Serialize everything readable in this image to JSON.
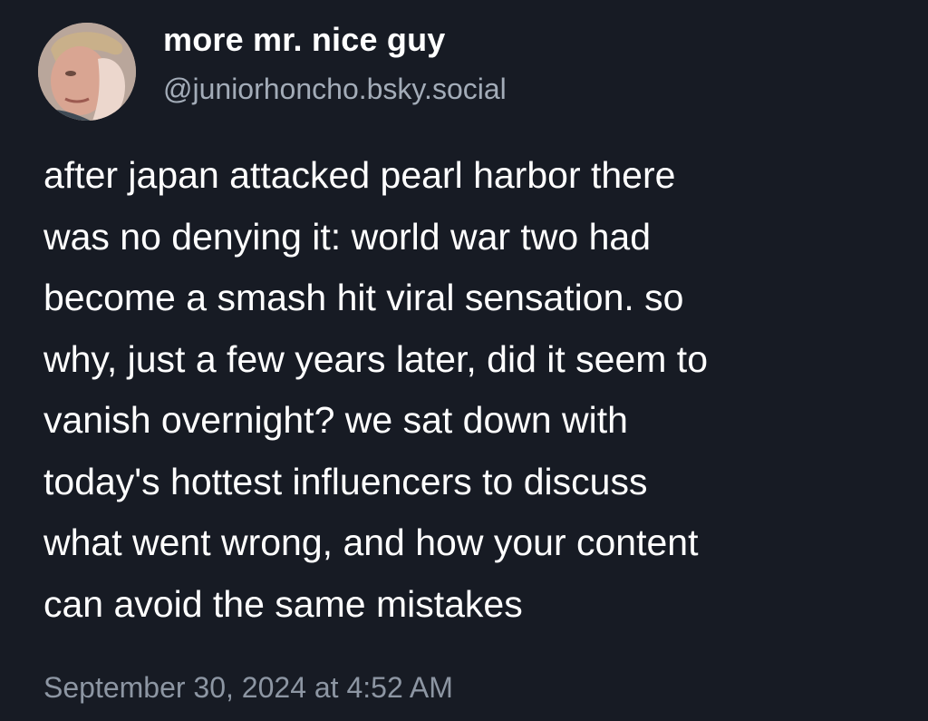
{
  "post": {
    "author": {
      "display_name": "more mr. nice guy",
      "handle": "@juniorhoncho.bsky.social"
    },
    "text_lines": [
      "after japan attacked pearl harbor there",
      "was no denying it: world war two had",
      "become a smash hit viral sensation. so",
      "why, just a few years later, did it seem to",
      "vanish overnight? we sat down with",
      "today's hottest influencers to discuss",
      "what went wrong, and how your content",
      "can avoid the same mistakes"
    ],
    "timestamp": "September 30, 2024 at 4:52 AM"
  },
  "colors": {
    "background": "#171b24",
    "text_primary": "#ffffff",
    "text_secondary": "#a3acb8",
    "timestamp": "#8d96a3"
  },
  "icons": {
    "avatar": "avatar-photo"
  }
}
